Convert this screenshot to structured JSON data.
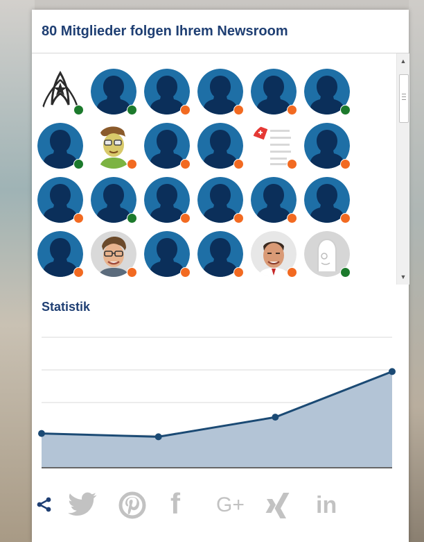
{
  "header": {
    "title": "80 Mitglieder folgen Ihrem Newsroom"
  },
  "members": {
    "follower_count": 80,
    "status_colors": {
      "online": "#1c7a2c",
      "away": "#f26a21"
    },
    "avatars": [
      {
        "kind": "logo",
        "status": "online"
      },
      {
        "kind": "placeholder",
        "status": "online"
      },
      {
        "kind": "placeholder",
        "status": "away"
      },
      {
        "kind": "placeholder",
        "status": "away"
      },
      {
        "kind": "placeholder",
        "status": "away"
      },
      {
        "kind": "placeholder",
        "status": "online"
      },
      {
        "kind": "placeholder",
        "status": "online"
      },
      {
        "kind": "photo-cartoon",
        "status": "away"
      },
      {
        "kind": "placeholder",
        "status": "away"
      },
      {
        "kind": "placeholder",
        "status": "away"
      },
      {
        "kind": "document",
        "status": "away"
      },
      {
        "kind": "placeholder",
        "status": "away"
      },
      {
        "kind": "placeholder",
        "status": "away"
      },
      {
        "kind": "placeholder",
        "status": "online"
      },
      {
        "kind": "placeholder",
        "status": "away"
      },
      {
        "kind": "placeholder",
        "status": "away"
      },
      {
        "kind": "placeholder",
        "status": "away"
      },
      {
        "kind": "placeholder",
        "status": "away"
      },
      {
        "kind": "placeholder",
        "status": "away"
      },
      {
        "kind": "photo-man",
        "status": "away"
      },
      {
        "kind": "placeholder",
        "status": "away"
      },
      {
        "kind": "placeholder",
        "status": "away"
      },
      {
        "kind": "photo-man-bald",
        "status": "away"
      },
      {
        "kind": "sketch",
        "status": "online"
      }
    ]
  },
  "statistics": {
    "title": "Statistik"
  },
  "chart_data": {
    "type": "area",
    "x": [
      1,
      2,
      3,
      4
    ],
    "values": [
      1.05,
      0.95,
      1.55,
      2.95
    ],
    "ylim": [
      0,
      4
    ],
    "grid": true,
    "colors": {
      "line": "#1b4a74",
      "fill": "#b3c4d6",
      "grid": "#d9d9d9",
      "axis": "#666666"
    }
  },
  "share": {
    "icons": [
      "share-icon",
      "twitter-icon",
      "pinterest-icon",
      "facebook-icon",
      "google-plus-icon",
      "xing-icon",
      "linkedin-icon"
    ],
    "text": {
      "facebook": "f",
      "google_plus": "G+",
      "linkedin": "in"
    },
    "colors": {
      "active": "#1f3f73",
      "inactive": "#c2c2c2"
    }
  }
}
